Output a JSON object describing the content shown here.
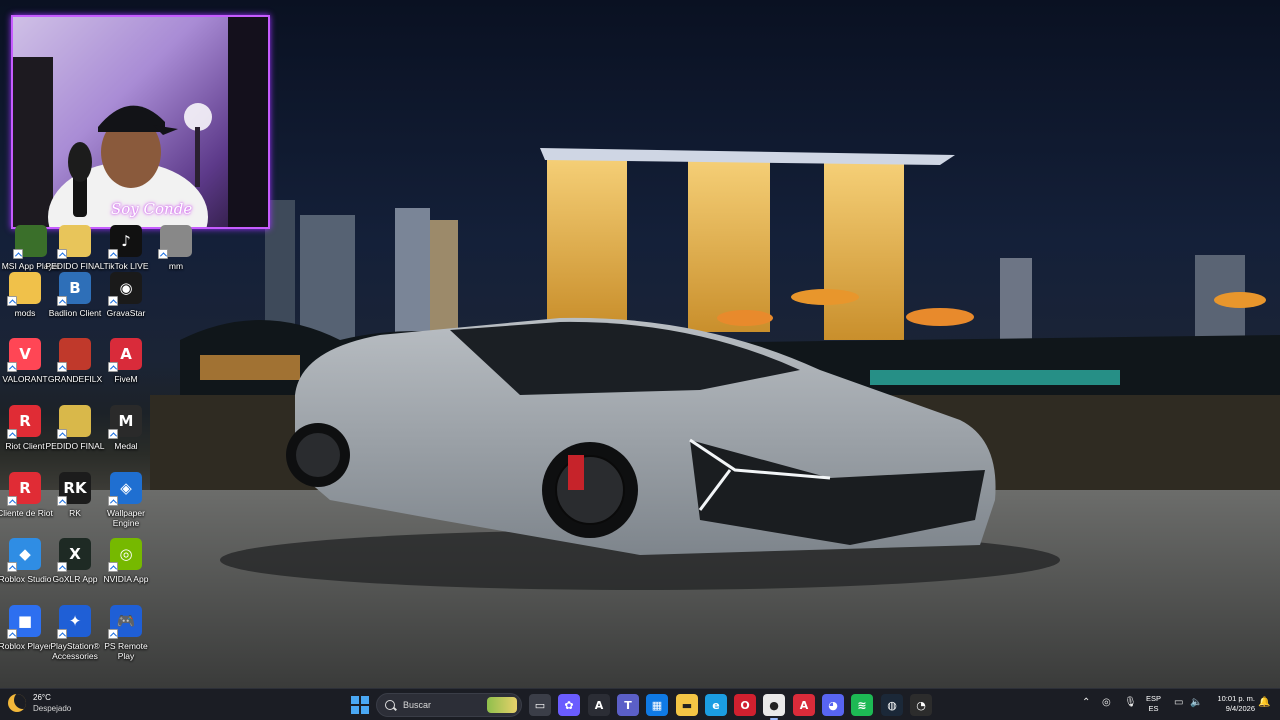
{
  "desktop": {
    "icons": [
      {
        "label": "MSI App Player",
        "color": "#3a6f2a",
        "glyph": "",
        "icon": "msi-app-player-icon"
      },
      {
        "label": "PEDIDO FINAL",
        "color": "#e8c55a",
        "glyph": "",
        "icon": "folder-icon"
      },
      {
        "label": "TikTok LIVE Studio",
        "color": "#111111",
        "glyph": "♪",
        "icon": "tiktok-live-icon"
      },
      {
        "label": "mm",
        "color": "#888888",
        "glyph": "",
        "icon": "file-icon"
      },
      {
        "label": "mods",
        "color": "#f0c14a",
        "glyph": "",
        "icon": "folder-icon"
      },
      {
        "label": "Badlion Client",
        "color": "#2e6fb8",
        "glyph": "B",
        "icon": "badlion-client-icon"
      },
      {
        "label": "GravaStar",
        "color": "#1a1a1a",
        "glyph": "◉",
        "icon": "gravastar-icon"
      },
      {
        "label": "VALORANT",
        "color": "#ff4655",
        "glyph": "V",
        "icon": "valorant-icon"
      },
      {
        "label": "GRANDEFILX",
        "color": "#c0392b",
        "glyph": "",
        "icon": "grandefilx-icon"
      },
      {
        "label": "FiveM",
        "color": "#d92b3a",
        "glyph": "A",
        "icon": "fivem-icon"
      },
      {
        "label": "Riot Client",
        "color": "#e02c35",
        "glyph": "R",
        "icon": "riot-client-icon"
      },
      {
        "label": "PEDIDO FINAL",
        "color": "#d9b84a",
        "glyph": "",
        "icon": "folder-icon"
      },
      {
        "label": "Medal",
        "color": "#2a2a2a",
        "glyph": "M",
        "icon": "medal-icon"
      },
      {
        "label": "Cliente de Riot",
        "color": "#e02c35",
        "glyph": "R",
        "icon": "riot-client-icon"
      },
      {
        "label": "RK",
        "color": "#1c1c1c",
        "glyph": "RK",
        "icon": "rk-icon"
      },
      {
        "label": "Wallpaper Engine",
        "color": "#1f6fd1",
        "glyph": "◈",
        "icon": "wallpaper-engine-icon"
      },
      {
        "label": "Roblox Studio",
        "color": "#2f8de4",
        "glyph": "◆",
        "icon": "roblox-studio-icon"
      },
      {
        "label": "GoXLR App",
        "color": "#1e2a24",
        "glyph": "X",
        "icon": "goxlr-icon"
      },
      {
        "label": "NVIDIA App",
        "color": "#76b900",
        "glyph": "◎",
        "icon": "nvidia-icon"
      },
      {
        "label": "Roblox Player",
        "color": "#2d6ff0",
        "glyph": "■",
        "icon": "roblox-player-icon"
      },
      {
        "label": "PlayStation® Accessories",
        "color": "#1f5fd6",
        "glyph": "✦",
        "icon": "playstation-accessories-icon"
      },
      {
        "label": "PS Remote Play",
        "color": "#1f5fd6",
        "glyph": "🎮",
        "icon": "ps-remote-play-icon"
      }
    ]
  },
  "webcam": {
    "overlay_name": "Soy Conde"
  },
  "taskbar": {
    "weather": {
      "temp": "26°C",
      "condition": "Despejado"
    },
    "search_placeholder": "Buscar",
    "apps": [
      {
        "name": "task-view",
        "color": "#3b3e48",
        "glyph": "▭"
      },
      {
        "name": "copilot",
        "color": "#6a5cff",
        "glyph": "✿"
      },
      {
        "name": "app-a",
        "color": "#2b2d35",
        "glyph": "A"
      },
      {
        "name": "teams",
        "color": "#5b5fc7",
        "glyph": "T"
      },
      {
        "name": "microsoft-store",
        "color": "#0f7ae5",
        "glyph": "▦"
      },
      {
        "name": "file-explorer",
        "color": "#f3c545",
        "glyph": "▬"
      },
      {
        "name": "edge",
        "color": "#1b9de2",
        "glyph": "e"
      },
      {
        "name": "opera",
        "color": "#d1202f",
        "glyph": "O"
      },
      {
        "name": "chrome",
        "color": "#e9e9e9",
        "glyph": "●"
      },
      {
        "name": "fivem-taskbar",
        "color": "#d92b3a",
        "glyph": "A"
      },
      {
        "name": "discord",
        "color": "#5865f2",
        "glyph": "◕"
      },
      {
        "name": "spotify",
        "color": "#1db954",
        "glyph": "≋"
      },
      {
        "name": "steam",
        "color": "#1b2838",
        "glyph": "◍"
      },
      {
        "name": "obs",
        "color": "#2c2c2c",
        "glyph": "◔"
      }
    ],
    "language": {
      "line1": "ESP",
      "line2": "ES"
    },
    "clock": {
      "time": "10:01 p. m.",
      "date": "9/4/2026"
    }
  }
}
